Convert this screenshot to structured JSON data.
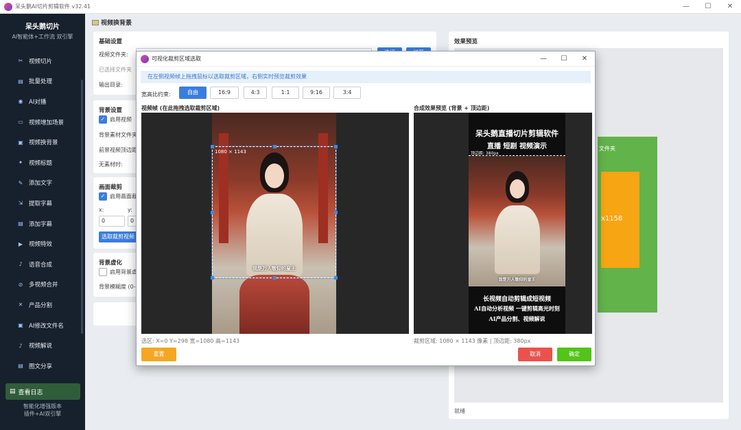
{
  "window": {
    "title": "呆头鹅AI切片剪辑软件 v32.41",
    "min": "—",
    "max": "☐",
    "close": "✕"
  },
  "sidebar": {
    "brand": "呆头鹅切片",
    "tagline": "AI智能体+工作流 双引擎",
    "items": [
      {
        "label": "视频切片",
        "icon": "scissors-icon"
      },
      {
        "label": "批量处理",
        "icon": "folder-icon"
      },
      {
        "label": "AI对播",
        "icon": "robot-icon"
      },
      {
        "label": "视频增加场景",
        "icon": "film-icon"
      },
      {
        "label": "视频换背景",
        "icon": "image-icon"
      },
      {
        "label": "视频标题",
        "icon": "sparkle-icon"
      },
      {
        "label": "添加文字",
        "icon": "pencil-icon"
      },
      {
        "label": "提取字幕",
        "icon": "extract-icon"
      },
      {
        "label": "添加字幕",
        "icon": "document-icon"
      },
      {
        "label": "视频特效",
        "icon": "video-icon"
      },
      {
        "label": "语音合成",
        "icon": "microphone-icon"
      },
      {
        "label": "多视频合并",
        "icon": "link-icon"
      },
      {
        "label": "产品分割",
        "icon": "cross-icon"
      },
      {
        "label": "AI修改文件名",
        "icon": "ai-icon"
      },
      {
        "label": "视频解说",
        "icon": "mic-icon"
      },
      {
        "label": "图文分享",
        "icon": "share-icon"
      }
    ],
    "log_button": "查看日志",
    "footer": [
      "智能化增强版本",
      "插件+AI双引擎"
    ]
  },
  "main": {
    "title": "视频换背景",
    "basic": {
      "heading": "基础设置",
      "video_folder": "视频文件夹:",
      "selected": "已选择文件夹",
      "output": "输出目录:",
      "browse": "选择",
      "open": "打开"
    },
    "background": {
      "heading": "背景设置",
      "enable": "启用视频",
      "bg_file": "背景素材文件夹",
      "front_top": "前景视频顶边距",
      "no_material": "无素材时:"
    },
    "crop": {
      "heading": "画面裁剪",
      "enable": "启用画面裁剪",
      "x_label": "x:",
      "y_label": "y:",
      "x_value": "0",
      "y_value": "0",
      "select_btn": "选取裁剪视频"
    },
    "blur": {
      "heading": "背景虚化",
      "enable": "启用背景虚化",
      "blur_level": "背景模糊度 (0-"
    }
  },
  "preview": {
    "heading": "效果预览",
    "green_text": "文件夹",
    "orange_text": "x1158",
    "status": "就绪"
  },
  "dialog": {
    "title": "可视化裁剪区域选取",
    "hint": "在左侧视频帧上拖拽鼠标以选取裁剪区域，右侧实时预览裁剪效果",
    "ratio_label": "宽高比约束:",
    "ratios": [
      {
        "label": "自由",
        "active": true
      },
      {
        "label": "16:9",
        "active": false
      },
      {
        "label": "4:3",
        "active": false
      },
      {
        "label": "1:1",
        "active": false
      },
      {
        "label": "9:16",
        "active": false
      },
      {
        "label": "3:4",
        "active": false
      }
    ],
    "frame_label": "视频帧 (在此拖拽选取裁剪区域)",
    "crop_dims": "1080 × 1143",
    "subtitle": "我是万人敬仰的皇王",
    "preview_label": "合成效果预览 (背景 + 顶边距)",
    "poster_title": "呆头鹅直播切片剪辑软件",
    "poster_sub": "直播 短剧 视频演示",
    "poster_top": "顶边距: 380px",
    "poster_lines": [
      "长视频自动剪辑成短视频",
      "AI自动分析视频 一键剪辑高光时刻",
      "AI产品分割、视频解说"
    ],
    "selection_info": "选区: X=0 Y=298 宽=1080 高=1143",
    "crop_info": "裁剪区域: 1080 × 1143 像素 | 顶边距: 380px",
    "reset": "重置",
    "cancel": "取消",
    "confirm": "确定"
  },
  "colors": {
    "sidebar": "#17202d",
    "accent": "#3b7ddd",
    "green": "#62b34a",
    "orange": "#f7a512",
    "danger": "#e9534b",
    "confirm": "#52c41a"
  }
}
